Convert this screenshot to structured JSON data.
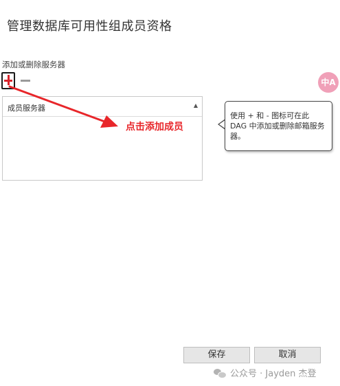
{
  "dialog": {
    "title": "管理数据库可用性组成员资格",
    "section_label": "添加或删除服务器"
  },
  "toolbar": {
    "add_icon": "plus-icon",
    "remove_icon": "minus-icon"
  },
  "table": {
    "column_header": "成员服务器",
    "sort_indicator": "▲",
    "rows": []
  },
  "tooltip": {
    "text": "使用 + 和 - 图标可在此 DAG 中添加或删除邮箱服务器。"
  },
  "annotation": {
    "text": "点击添加成员",
    "color": "#e8262a"
  },
  "translate_button": {
    "label": "中A"
  },
  "footer": {
    "save_label": "保存",
    "cancel_label": "取消"
  },
  "watermark": {
    "text": "公众号 · Jayden 杰登"
  }
}
